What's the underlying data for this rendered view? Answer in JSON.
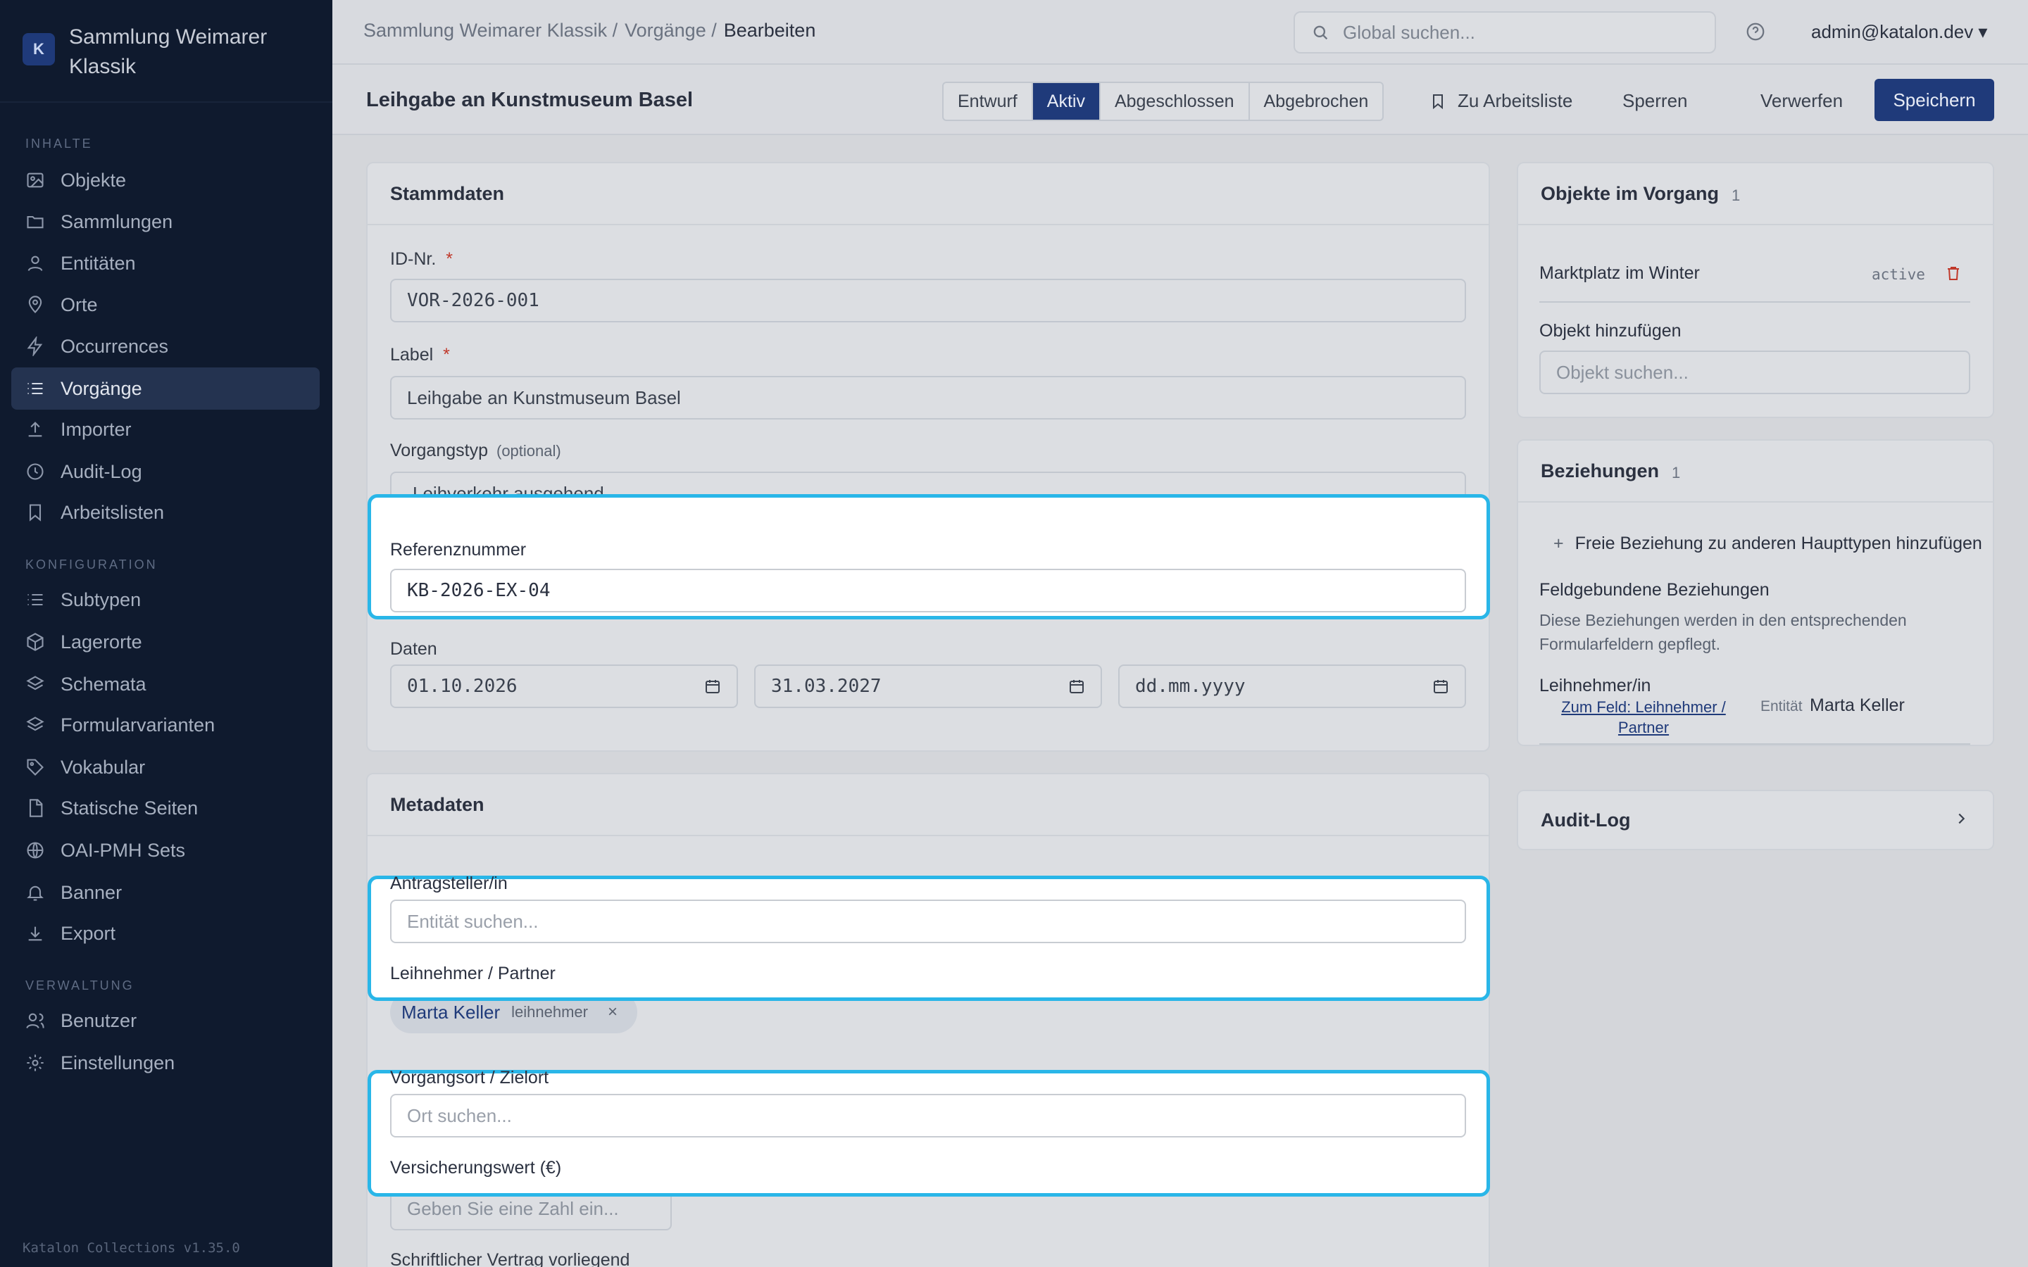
{
  "sidebar": {
    "logo_letter": "K",
    "title": "Sammlung Weimarer Klassik",
    "sections": {
      "inhalte": "INHALTE",
      "konfiguration": "KONFIGURATION",
      "verwaltung": "VERWALTUNG"
    },
    "items": [
      {
        "label": "Objekte",
        "icon": "image-icon"
      },
      {
        "label": "Sammlungen",
        "icon": "folder-icon"
      },
      {
        "label": "Entitäten",
        "icon": "person-icon"
      },
      {
        "label": "Orte",
        "icon": "map-pin-icon"
      },
      {
        "label": "Occurrences",
        "icon": "lightning-icon"
      },
      {
        "label": "Vorgänge",
        "icon": "list-icon",
        "active": true
      },
      {
        "label": "Importer",
        "icon": "upload-icon"
      },
      {
        "label": "Audit-Log",
        "icon": "clock-icon"
      },
      {
        "label": "Arbeitslisten",
        "icon": "bookmark-icon"
      },
      {
        "label": "Subtypen",
        "icon": "list-icon"
      },
      {
        "label": "Lagerorte",
        "icon": "box-icon"
      },
      {
        "label": "Schemata",
        "icon": "layers-icon"
      },
      {
        "label": "Formularvarianten",
        "icon": "layers-icon"
      },
      {
        "label": "Vokabular",
        "icon": "tag-icon"
      },
      {
        "label": "Statische Seiten",
        "icon": "file-icon"
      },
      {
        "label": "OAI-PMH Sets",
        "icon": "globe-icon"
      },
      {
        "label": "Banner",
        "icon": "bell-icon"
      },
      {
        "label": "Export",
        "icon": "download-icon"
      },
      {
        "label": "Benutzer",
        "icon": "person-icon"
      },
      {
        "label": "Einstellungen",
        "icon": "gear-icon"
      }
    ],
    "version": "Katalon Collections v1.35.0"
  },
  "topbar": {
    "breadcrumb": [
      "Sammlung Weimarer Klassik /",
      "Vorgänge /",
      "Bearbeiten"
    ],
    "search_placeholder": "Global suchen...",
    "user": "admin@katalon.dev ▾"
  },
  "header": {
    "title": "Leihgabe an Kunstmuseum Basel",
    "statuses": [
      "Entwurf",
      "Aktiv",
      "Abgeschlossen",
      "Abgebrochen"
    ],
    "selected_status": "Aktiv",
    "worklist": "Zu Arbeitsliste",
    "lock": "Sperren",
    "discard": "Verwerfen",
    "save": "Speichern"
  },
  "stammdaten": {
    "title": "Stammdaten",
    "id_label": "ID-Nr.",
    "id_value": "VOR-2026-001",
    "label_label": "Label",
    "label_value": "Leihgabe an Kunstmuseum Basel",
    "required_mark": "*",
    "type_label": "Vorgangstyp",
    "type_optional": "(optional)",
    "type_value": "Leihverkehr ausgehend",
    "ref_label": "Referenznummer",
    "ref_value": "KB-2026-EX-04",
    "dates_label": "Daten",
    "date1": "01.10.2026",
    "date2": "31.03.2027",
    "date3": "dd.mm.yyyy"
  },
  "metadaten": {
    "title": "Metadaten",
    "applicant_label": "Antragsteller/in",
    "applicant_placeholder": "Entität suchen...",
    "borrower_label": "Leihnehmer / Partner",
    "chip_name": "Marta Keller",
    "chip_role": "leihnehmer",
    "chip_remove": "×",
    "place_label": "Vorgangsort / Zielort",
    "place_placeholder": "Ort suchen...",
    "insurance_label": "Versicherungswert (€)",
    "insurance_placeholder": "Geben Sie eine Zahl ein...",
    "contract_label": "Schriftlicher Vertrag vorliegend"
  },
  "objects_panel": {
    "title": "Objekte im Vorgang",
    "count": "1",
    "item": "Marktplatz im Winter",
    "item_status": "active",
    "add_label": "Objekt hinzufügen",
    "add_placeholder": "Objekt suchen..."
  },
  "relations_panel": {
    "title": "Beziehungen",
    "count": "1",
    "add_free": "Freie Beziehung zu anderen Haupttypen hinzufügen",
    "field_bound_title": "Feldgebundene Beziehungen",
    "field_bound_desc_1": "Diese Beziehungen werden in den entsprechenden",
    "field_bound_desc_2": "Formularfeldern gepflegt.",
    "relation_label": "Leihnehmer/in",
    "relation_link_1": "Zum Feld: Leihnehmer /",
    "relation_link_2": "Partner",
    "relation_type": "Entität",
    "relation_value": "Marta Keller"
  },
  "audit_panel": {
    "title": "Audit-Log"
  },
  "colors": {
    "sidebar_bg": "#0f1a2e",
    "accent": "#1f3a7a",
    "highlight_border": "#29b6e8",
    "danger": "#c0392b"
  }
}
